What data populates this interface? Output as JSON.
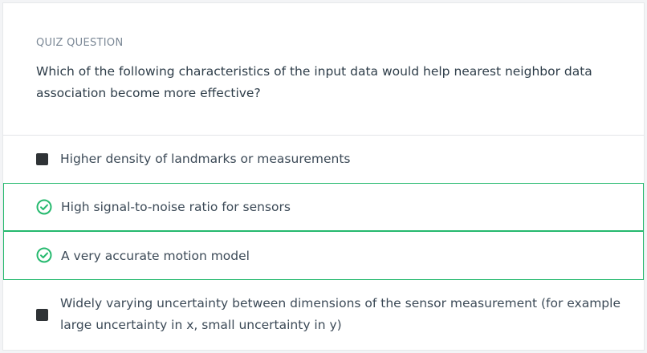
{
  "quiz": {
    "label": "QUIZ QUESTION",
    "question": "Which of the following characteristics of the input data would help nearest neighbor data association become more effective?"
  },
  "options": [
    {
      "text": "Higher density of landmarks or measurements",
      "selected": false
    },
    {
      "text": "High signal-to-noise ratio for sensors",
      "selected": true
    },
    {
      "text": "A very accurate motion model",
      "selected": true
    },
    {
      "text": "Widely varying uncertainty between dimensions of the sensor measurement (for example large uncertainty in x, small uncertainty in y)",
      "selected": false
    }
  ],
  "colors": {
    "accent": "#25b96e",
    "text": "#2e3d49",
    "muted": "#7b8896",
    "checkbox": "#2f3336"
  },
  "icons": {
    "unselected": "checkbox-filled-icon",
    "selected": "check-circle-icon"
  }
}
